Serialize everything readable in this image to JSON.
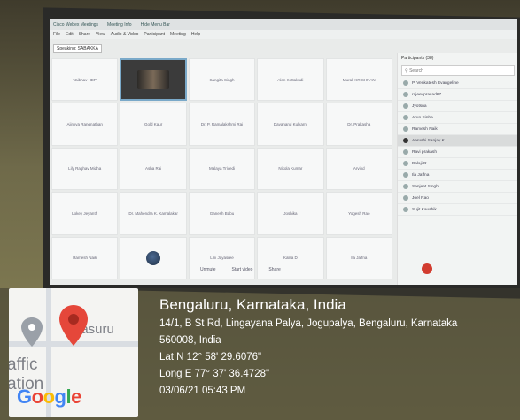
{
  "screen": {
    "titlebar": [
      "Cisco Webex Meetings",
      "Meeting Info",
      "Hide Menu Bar"
    ],
    "menubar": [
      "File",
      "Edit",
      "Share",
      "View",
      "Audio & Video",
      "Participant",
      "Meeting",
      "Help"
    ],
    "speaking": "Speaking: SABAKKA",
    "tiles": [
      "Vaibhav HEP",
      "[video]",
      "Sangita Singh",
      "Alen Kottakudi",
      "Murali KRISHNAN",
      "Ajinkya Rangnathan",
      "Gold Kaur",
      "Dr. P. Ramalakshmi Raj",
      "Dayanand Kulkarni",
      "Dr. Prakasha",
      "Lily Raghav Midha",
      "Asha Rai",
      "Malaya Trivedi",
      "Nikola Kumar",
      "Arvind",
      "Lokey Jeyanth",
      "Dr. Mahendra K. Kamalakar",
      "Ganesh Babu",
      "Joshika",
      "Yogesh Rao",
      "Ramesh Naik",
      "[avatar]",
      "Lini Jayasree",
      "Kalita D",
      "Ila Jaffna"
    ],
    "panel_title": "Participants (38)",
    "search_placeholder": "Search",
    "participants": [
      "P. Venkatesh Evangeline",
      "rajeevprasad67",
      "Jyotsna",
      "Arun Sinha",
      "Ramesh Naik",
      "Aarushi Sanjay K",
      "Ravi prakash",
      "Balaji R",
      "Ila Jaffna",
      "Sanjeet Singh",
      "Joel Rao",
      "Sujit Kaushik"
    ],
    "toolbar": [
      "Unmute",
      "Start video",
      "Share"
    ]
  },
  "location": {
    "city": "Bengaluru, Karnataka, India",
    "address_line1": "14/1, B St Rd, Lingayana Palya, Jogupalya, Bengaluru, Karnataka",
    "address_line2": "560008, India",
    "lat": "Lat N 12° 58' 29.6076\"",
    "long": "Long E 77° 37' 36.4728\"",
    "timestamp": "03/06/21 05:43 PM"
  },
  "map": {
    "label1": "affic",
    "label2": "ation",
    "place_fragment": "lasuru",
    "brand": "Google",
    "brand_colors": [
      "#4285F4",
      "#EA4335",
      "#FBBC05",
      "#4285F4",
      "#34A853",
      "#EA4335"
    ]
  }
}
